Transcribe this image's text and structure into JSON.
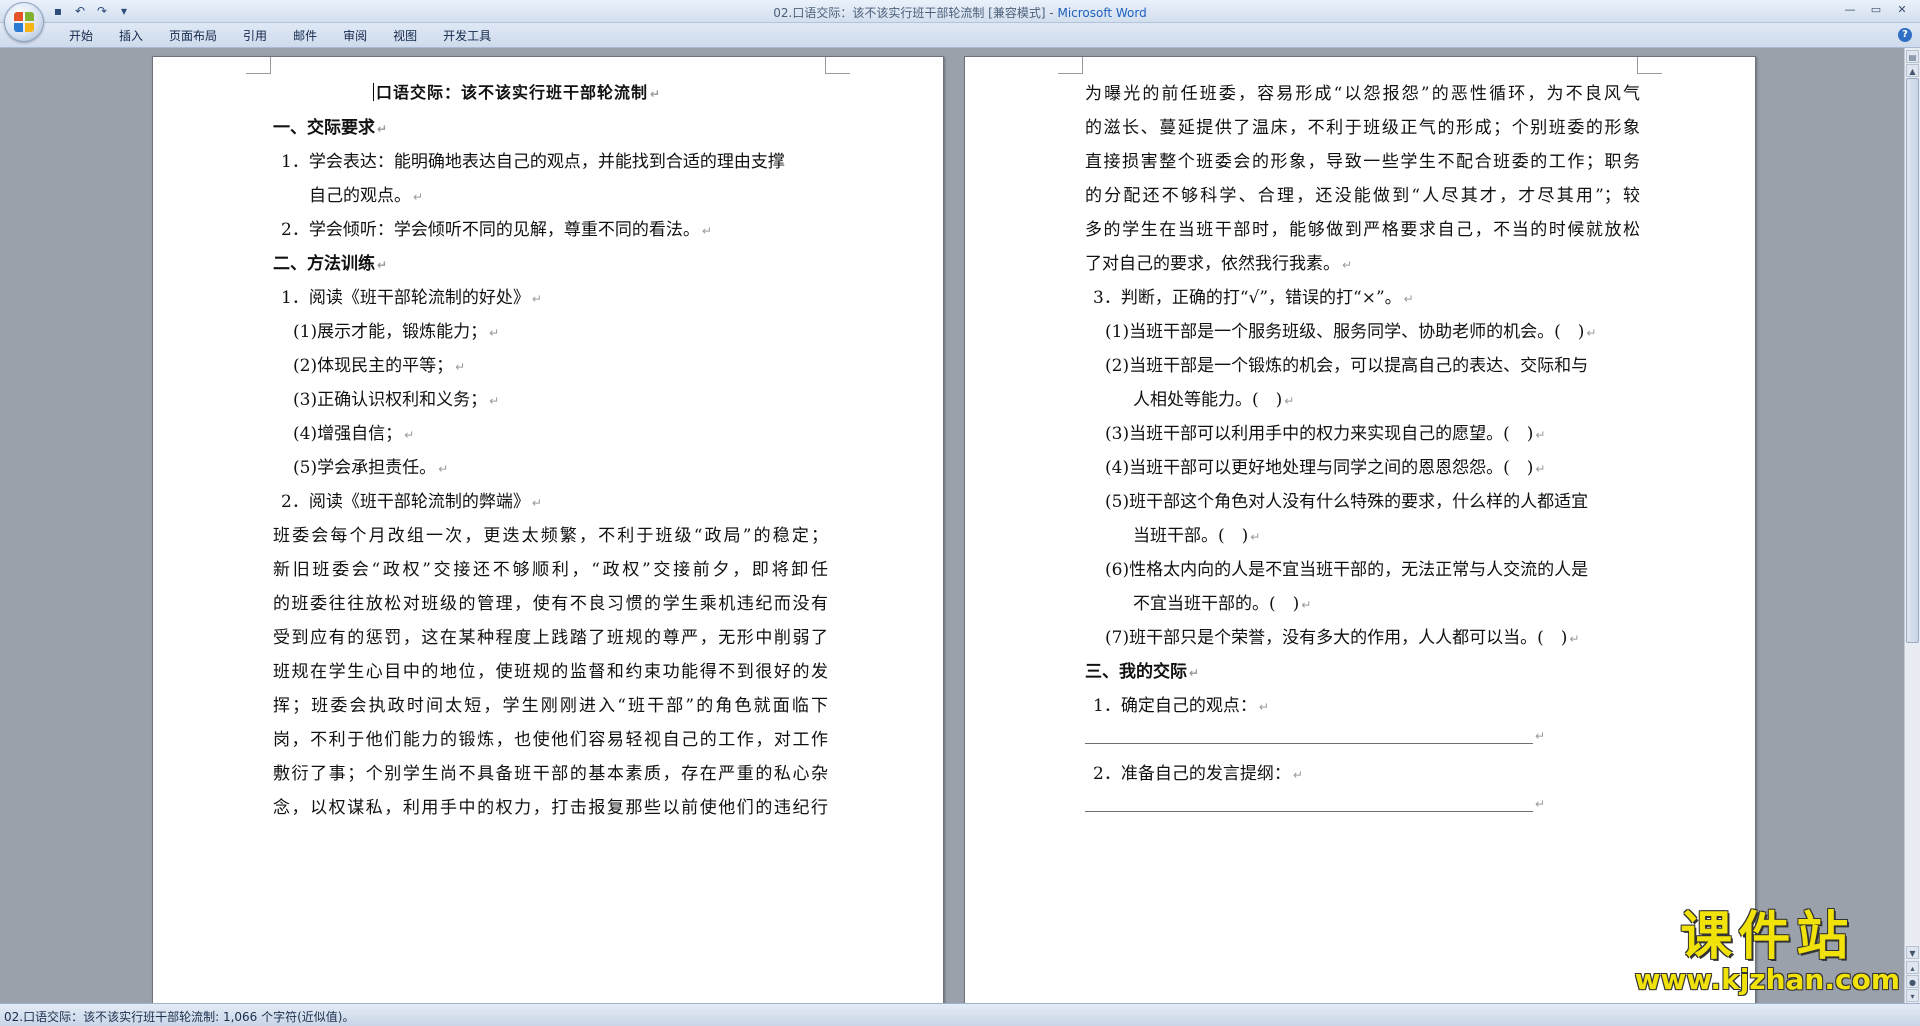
{
  "window": {
    "title_doc": "02.口语交际：该不该实行班干部轮流制 [兼容模式] - ",
    "title_app": "Microsoft Word"
  },
  "ribbon": {
    "tabs": [
      "开始",
      "插入",
      "页面布局",
      "引用",
      "邮件",
      "审阅",
      "视图",
      "开发工具"
    ]
  },
  "page_left": {
    "title": "口语交际：该不该实行班干部轮流制",
    "lines": [
      "一、交际要求",
      "1．学会表达：能明确地表达自己的观点，并能找到合适的理由支撑",
      "自己的观点。",
      "2．学会倾听：学会倾听不同的见解，尊重不同的看法。",
      "二、方法训练",
      "1．阅读《班干部轮流制的好处》",
      "(1)展示才能，锻炼能力；",
      "(2)体现民主的平等；",
      "(3)正确认识权利和义务；",
      "(4)增强自信；",
      "(5)学会承担责任。",
      "2．阅读《班干部轮流制的弊端》",
      "班委会每个月改组一次，更迭太频繁，不利于班级“政局”的稳定；",
      "新旧班委会“政权”交接还不够顺利，“政权”交接前夕，即将卸任",
      "的班委往往放松对班级的管理，使有不良习惯的学生乘机违纪而没有",
      "受到应有的惩罚，这在某种程度上践踏了班规的尊严，无形中削弱了",
      "班规在学生心目中的地位，使班规的监督和约束功能得不到很好的发",
      "挥；班委会执政时间太短，学生刚刚进入“班干部”的角色就面临下",
      "岗，不利于他们能力的锻炼，也使他们容易轻视自己的工作，对工作",
      "敷衍了事；个别学生尚不具备班干部的基本素质，存在严重的私心杂",
      "念，以权谋私，利用手中的权力，打击报复那些以前使他们的违纪行"
    ]
  },
  "page_right": {
    "lines": [
      "为曝光的前任班委，容易形成“以怨报怨”的恶性循环，为不良风气",
      "的滋长、蔓延提供了温床，不利于班级正气的形成；个别班委的形象",
      "直接损害整个班委会的形象，导致一些学生不配合班委的工作；职务",
      "的分配还不够科学、合理，还没能做到“人尽其才，才尽其用”；较",
      "多的学生在当班干部时，能够做到严格要求自己，不当的时候就放松",
      "了对自己的要求，依然我行我素。",
      "3．判断，正确的打“√”，错误的打“×”。",
      "(1)当班干部是一个服务班级、服务同学、协助老师的机会。(　)",
      "(2)当班干部是一个锻炼的机会，可以提高自己的表达、交际和与",
      "人相处等能力。(　)",
      "(3)当班干部可以利用手中的权力来实现自己的愿望。(　)",
      "(4)当班干部可以更好地处理与同学之间的恩恩怨怨。(　)",
      "(5)班干部这个角色对人没有什么特殊的要求，什么样的人都适宜",
      "当班干部。(　)",
      "(6)性格太内向的人是不宜当班干部的，无法正常与人交流的人是",
      "不宜当班干部的。(　)",
      "(7)班干部只是个荣誉，没有多大的作用，人人都可以当。(　)",
      "三、我的交际",
      "1．确定自己的观点：",
      "________________________________________________________",
      "2．准备自己的发言提纲：",
      "________________________________________________________"
    ]
  },
  "status": {
    "text": "02.口语交际：该不该实行班干部轮流制: 1,066 个字符(近似值)。"
  },
  "watermark": {
    "big": "课件站",
    "small": "www.kjzhan.com"
  }
}
